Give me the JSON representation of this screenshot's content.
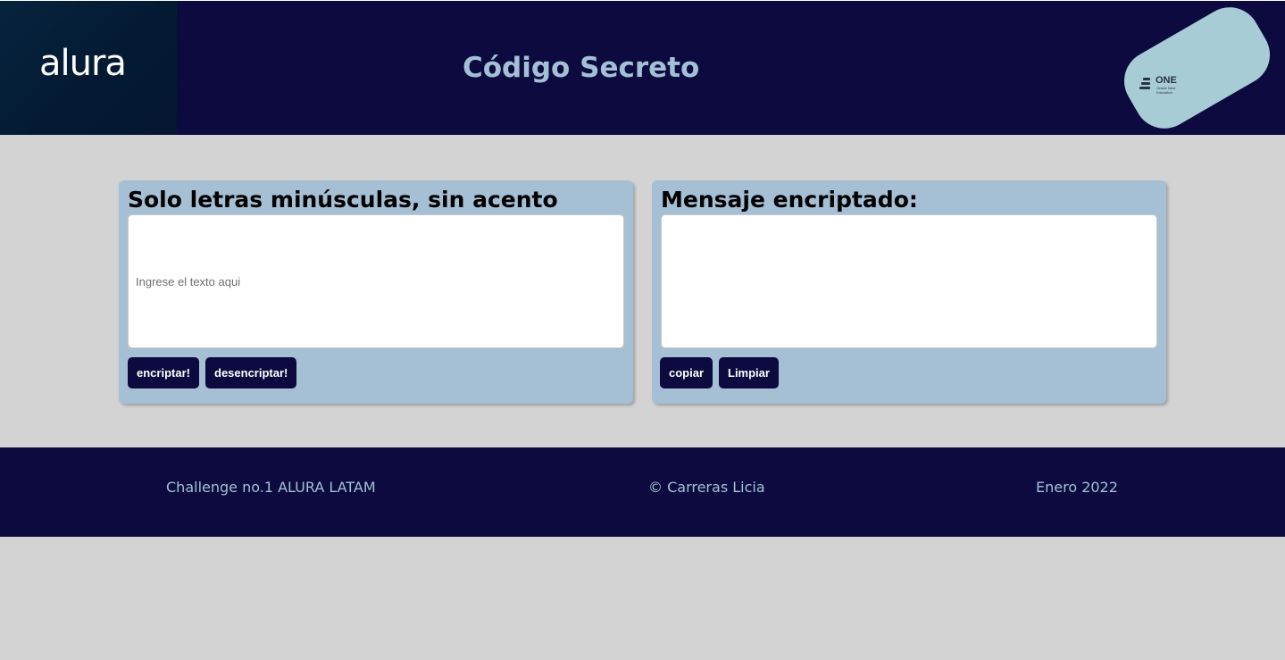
{
  "header": {
    "logo_text": "alura",
    "title": "Código Secreto",
    "badge": {
      "word": "ONE",
      "subtitle": "Oracle Next Education"
    }
  },
  "input_panel": {
    "heading": "Solo letras minúsculas, sin acento",
    "placeholder": "Ingrese el texto aqui",
    "value": "",
    "encrypt_label": "encriptar!",
    "decrypt_label": "desencriptar!"
  },
  "output_panel": {
    "heading": "Mensaje encriptado:",
    "value": "",
    "copy_label": "copiar",
    "clear_label": "Limpiar"
  },
  "footer": {
    "challenge": "Challenge no.1 ALURA LATAM",
    "author": "© Carreras Licia",
    "date": "Enero 2022"
  },
  "colors": {
    "header_bg": "#0c0a3e",
    "title_color": "#a3c1d6",
    "page_bg": "#d3d3d3",
    "panel_bg": "#a5c0d4",
    "button_bg": "#0c0a3e",
    "badge_bg": "#a7ccd6"
  }
}
